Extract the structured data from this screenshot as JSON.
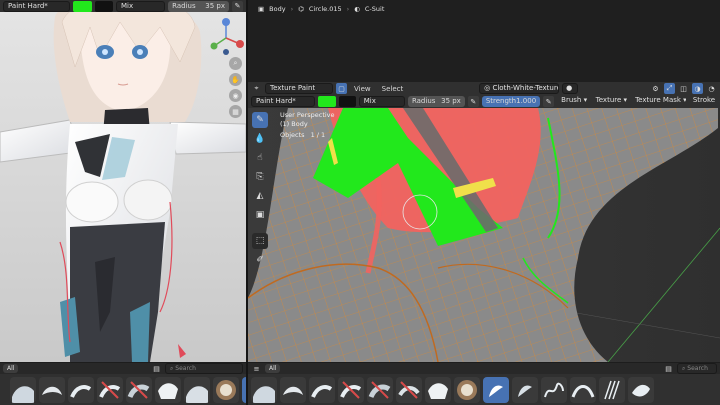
{
  "left_header": {
    "mode": "Paint Hard*",
    "color": "#22e81c",
    "color2": "#111111",
    "blend": "Mix",
    "radius_label": "Radius",
    "radius_value": "35 px"
  },
  "breadcrumb": {
    "object": "Body",
    "mesh": "Circle.015",
    "material": "C-Suit"
  },
  "editor_header": {
    "mode": "Texture Paint",
    "view": "View",
    "select": "Select",
    "texture": "Cloth-White-Texture"
  },
  "tool_header": {
    "brush": "Paint Hard*",
    "color": "#22e81c",
    "color2": "#111111",
    "blend": "Mix",
    "radius_label": "Radius",
    "radius_value": "35 px",
    "strength_label": "Strength",
    "strength_value": "1.000",
    "brush_menu": "Brush",
    "texture_menu": "Texture",
    "texture_mask_menu": "Texture Mask",
    "stroke_menu": "Stroke"
  },
  "viewport_info": {
    "line1": "User Perspective",
    "line2": "(1) Body",
    "objects_label": "Objects",
    "objects_value": "1 / 1"
  },
  "asset_shelf_left": {
    "tab": "All",
    "search_placeholder": "Search"
  },
  "asset_shelf_right": {
    "tab": "All",
    "search_placeholder": "Search"
  },
  "colors": {
    "accent": "#4772b3",
    "paint_green": "#22e81c",
    "suit_red": "#f2635f",
    "wire": "#e2892a"
  }
}
